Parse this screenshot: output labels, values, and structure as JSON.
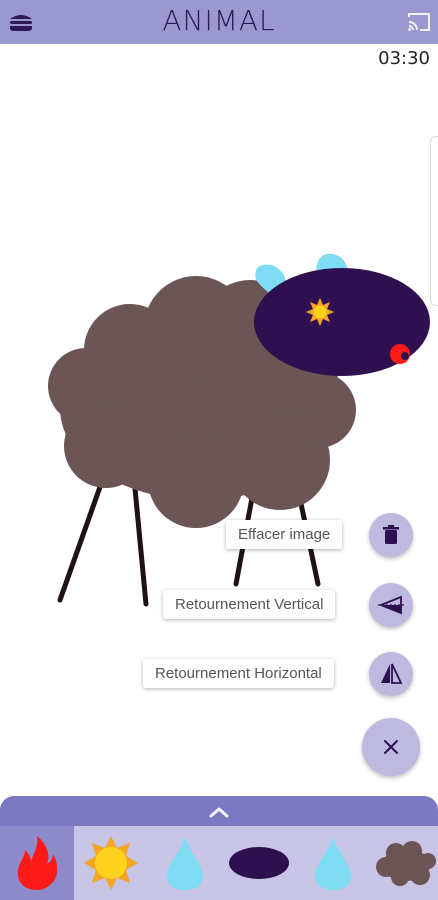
{
  "header": {
    "title": "ANIMAL",
    "menu_icon": "burger-menu-icon",
    "cast_icon": "cast-icon"
  },
  "timer": "03:30",
  "actions": {
    "clear_label": "Effacer image",
    "flip_vertical_label": "Retournement Vertical",
    "flip_horizontal_label": "Retournement Horizontal",
    "clear_icon": "trash-icon",
    "flip_vertical_icon": "flip-vertical-icon",
    "flip_horizontal_icon": "flip-horizontal-icon",
    "close_icon": "close-icon"
  },
  "palette": {
    "expand_icon": "chevron-up-icon",
    "items": [
      {
        "name": "fire",
        "color": "#ff1a1a",
        "selected": true
      },
      {
        "name": "sun",
        "color": "#ffd21f"
      },
      {
        "name": "water-drop",
        "color": "#7fdcf2"
      },
      {
        "name": "ellipse",
        "color": "#2e1050"
      },
      {
        "name": "water-drop",
        "color": "#7fdcf2"
      },
      {
        "name": "cloud",
        "color": "#6b5454"
      }
    ]
  },
  "colors": {
    "header": "#9b97cf",
    "fab": "#bdb9df",
    "drawer": "#7d78c2",
    "palette_bg": "#c7c4e6",
    "palette_selected": "#8e8ac9",
    "sheep_body": "#6b5555",
    "sheep_head": "#2e1050",
    "ears": "#7fdcf2",
    "legs": "#1e1212"
  }
}
